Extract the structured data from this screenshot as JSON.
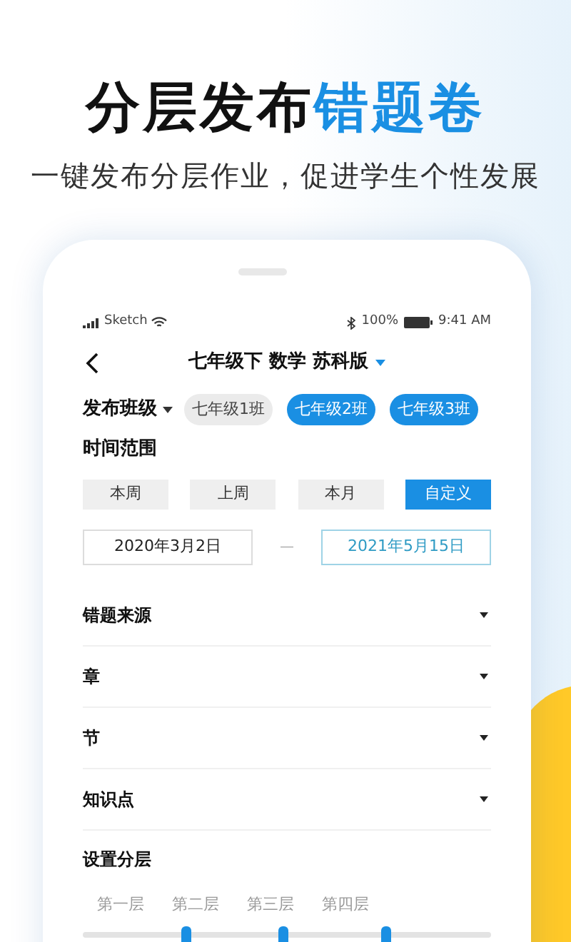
{
  "headline": {
    "plain": "分层发布",
    "accent": "错题卷"
  },
  "subtitle": "一键发布分层作业，促进学生个性发展",
  "status_bar": {
    "carrier": "Sketch",
    "battery": "100%",
    "time": "9:41 AM"
  },
  "nav": {
    "title": "七年级下 数学 苏科版"
  },
  "classes": {
    "label": "发布班级",
    "chips": [
      {
        "label": "七年级1班",
        "selected": false
      },
      {
        "label": "七年级2班",
        "selected": true
      },
      {
        "label": "七年级3班",
        "selected": true
      }
    ]
  },
  "time_range": {
    "label": "时间范围",
    "periods": [
      {
        "label": "本周",
        "selected": false
      },
      {
        "label": "上周",
        "selected": false
      },
      {
        "label": "本月",
        "selected": false
      },
      {
        "label": "自定义",
        "selected": true
      }
    ],
    "start": {
      "value": "2020年3月2日",
      "active": false
    },
    "separator": "—",
    "end": {
      "value": "2021年5月15日",
      "active": true
    }
  },
  "filters": [
    "错题来源",
    "章",
    "节",
    "知识点"
  ],
  "layers": {
    "label": "设置分层",
    "names": [
      "第一层",
      "第二层",
      "第三层",
      "第四层"
    ],
    "thumbs": [
      {
        "level": 0.25
      },
      {
        "level": 0.49
      },
      {
        "level": 0.74
      }
    ]
  }
}
